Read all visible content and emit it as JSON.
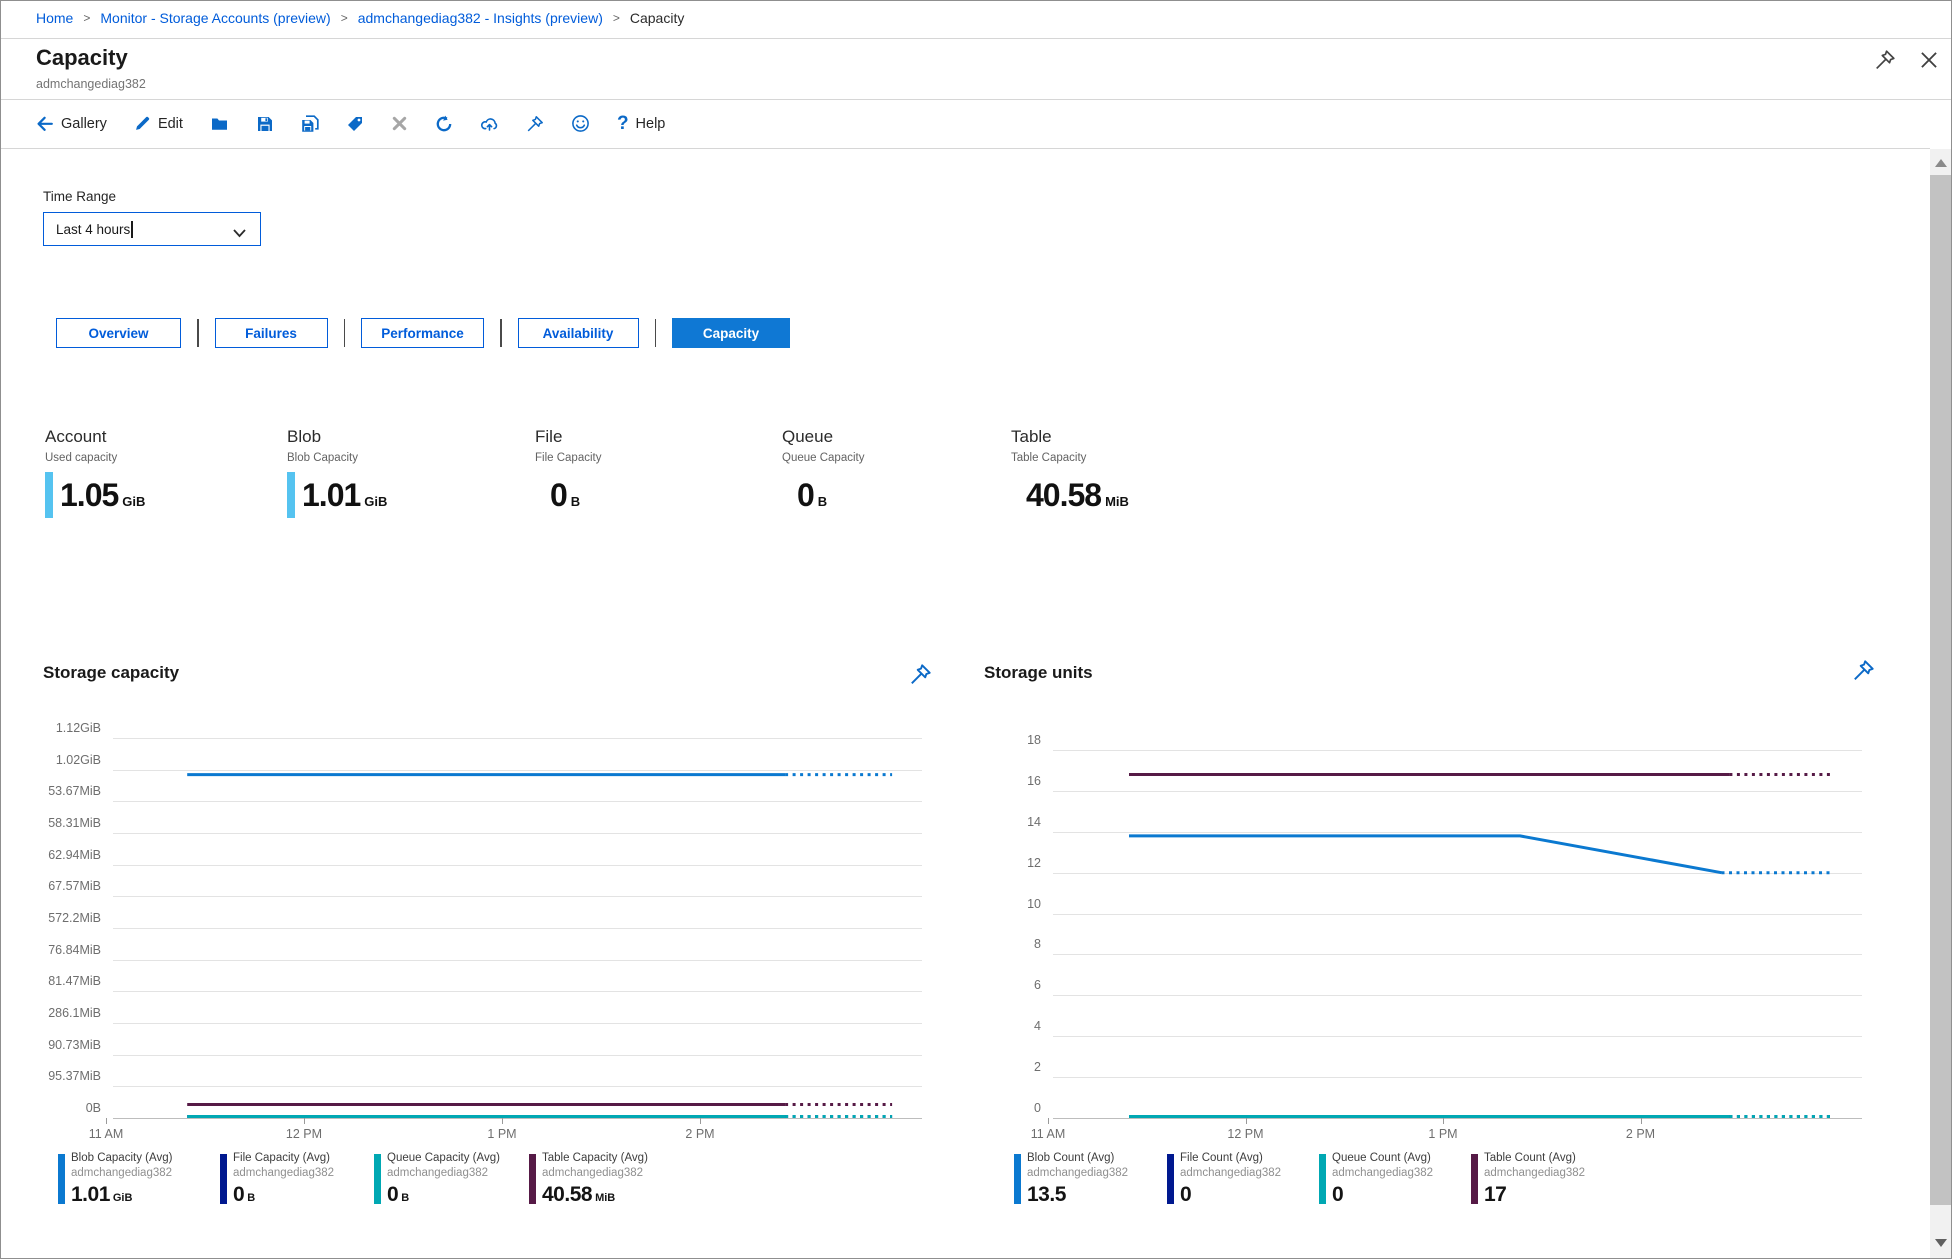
{
  "breadcrumb": {
    "separator": ">",
    "items": [
      {
        "label": "Home",
        "link": true
      },
      {
        "label": "Monitor - Storage Accounts (preview)",
        "link": true
      },
      {
        "label": "admchangediag382 - Insights (preview)",
        "link": true
      },
      {
        "label": "Capacity",
        "link": false
      }
    ]
  },
  "header": {
    "title": "Capacity",
    "subtitle": "admchangediag382"
  },
  "toolbar": {
    "items": [
      {
        "icon": "back-arrow",
        "label": "Gallery"
      },
      {
        "icon": "edit-pencil",
        "label": "Edit"
      },
      {
        "icon": "folder",
        "label": ""
      },
      {
        "icon": "save",
        "label": ""
      },
      {
        "icon": "save-copy",
        "label": ""
      },
      {
        "icon": "tag",
        "label": ""
      },
      {
        "icon": "discard-x",
        "label": ""
      },
      {
        "icon": "refresh",
        "label": ""
      },
      {
        "icon": "cloud-upload",
        "label": ""
      },
      {
        "icon": "pin",
        "label": ""
      },
      {
        "icon": "smiley-feedback",
        "label": ""
      },
      {
        "icon": "question-mark",
        "label": "Help"
      }
    ]
  },
  "time_range": {
    "label": "Time Range",
    "value": "Last 4 hours"
  },
  "tabs": [
    {
      "label": "Overview",
      "active": false
    },
    {
      "label": "Failures",
      "active": false
    },
    {
      "label": "Performance",
      "active": false
    },
    {
      "label": "Availability",
      "active": false
    },
    {
      "label": "Capacity",
      "active": true
    }
  ],
  "cards": [
    {
      "title": "Account",
      "metric": "Used capacity",
      "value": "1.05",
      "unit": "GiB",
      "bar": true
    },
    {
      "title": "Blob",
      "metric": "Blob Capacity",
      "value": "1.01",
      "unit": "GiB",
      "bar": true
    },
    {
      "title": "File",
      "metric": "File Capacity",
      "value": "0",
      "unit": "B",
      "bar": false
    },
    {
      "title": "Queue",
      "metric": "Queue Capacity",
      "value": "0",
      "unit": "B",
      "bar": false
    },
    {
      "title": "Table",
      "metric": "Table Capacity",
      "value": "40.58",
      "unit": "MiB",
      "bar": false
    }
  ],
  "colors": {
    "link_blue": "#015cda",
    "active_tab": "#0f78d4",
    "card_bar_light_blue": "#55c3f0",
    "blob": "#0b79d0",
    "file": "#00188f",
    "queue": "#00a8b3",
    "table": "#561a46"
  },
  "chart_data": [
    {
      "type": "line",
      "title": "Storage capacity",
      "y_axis": {
        "unit": "MiB",
        "max": 1144.44,
        "min": 0,
        "labels_top_to_bottom": [
          "1.12GiB",
          "1.02GiB",
          "53.67MiB",
          "58.31MiB",
          "62.94MiB",
          "67.57MiB",
          "572.2MiB",
          "76.84MiB",
          "81.47MiB",
          "286.1MiB",
          "90.73MiB",
          "95.37MiB",
          "0B"
        ]
      },
      "x_axis": {
        "labels": [
          "11 AM",
          "12 PM",
          "1 PM",
          "2 PM"
        ],
        "hours_shown": 4
      },
      "legend_position": "bottom",
      "grid": true,
      "series": [
        {
          "name": "Blob Capacity (Avg)",
          "resource": "admchangediag382",
          "color": "#0b79d0",
          "value": "1.01",
          "unit": "GiB",
          "points": [
            [
              0.41,
              1034.24
            ],
            [
              3.43,
              1034.24
            ]
          ],
          "forecast": [
            [
              3.43,
              1034.24
            ],
            [
              3.97,
              1034.24
            ]
          ]
        },
        {
          "name": "File Capacity (Avg)",
          "resource": "admchangediag382",
          "color": "#00188f",
          "value": "0",
          "unit": "B",
          "points": [
            [
              0.41,
              0
            ],
            [
              3.43,
              0
            ]
          ],
          "forecast": [
            [
              3.43,
              0
            ],
            [
              3.97,
              0
            ]
          ]
        },
        {
          "name": "Queue Capacity (Avg)",
          "resource": "admchangediag382",
          "color": "#00a8b3",
          "value": "0",
          "unit": "B",
          "points": [
            [
              0.41,
              0
            ],
            [
              3.43,
              0
            ]
          ],
          "forecast": [
            [
              3.43,
              0
            ],
            [
              3.97,
              0
            ]
          ]
        },
        {
          "name": "Table Capacity (Avg)",
          "resource": "admchangediag382",
          "color": "#561a46",
          "value": "40.58",
          "unit": "MiB",
          "points": [
            [
              0.41,
              40.58
            ],
            [
              3.43,
              40.58
            ]
          ],
          "forecast": [
            [
              3.43,
              40.58
            ],
            [
              3.97,
              40.58
            ]
          ]
        }
      ]
    },
    {
      "type": "line",
      "title": "Storage units",
      "y_axis": {
        "unit": "count",
        "max": 18,
        "min": 0,
        "labels_top_to_bottom": [
          "18",
          "16",
          "14",
          "12",
          "10",
          "8",
          "6",
          "4",
          "2",
          "0"
        ]
      },
      "x_axis": {
        "labels": [
          "11 AM",
          "12 PM",
          "1 PM",
          "2 PM"
        ],
        "hours_shown": 4
      },
      "legend_position": "bottom",
      "grid": true,
      "series": [
        {
          "name": "Blob Count (Avg)",
          "resource": "admchangediag382",
          "color": "#0b79d0",
          "value": "13.5",
          "unit": "",
          "points": [
            [
              0.41,
              13.8
            ],
            [
              2.39,
              13.8
            ],
            [
              3.41,
              12.0
            ]
          ],
          "forecast": [
            [
              3.41,
              12.0
            ],
            [
              3.97,
              12.0
            ]
          ]
        },
        {
          "name": "File Count (Avg)",
          "resource": "admchangediag382",
          "color": "#00188f",
          "value": "0",
          "unit": "",
          "points": [
            [
              0.41,
              0
            ],
            [
              3.45,
              0
            ]
          ],
          "forecast": [
            [
              3.45,
              0
            ],
            [
              3.97,
              0
            ]
          ]
        },
        {
          "name": "Queue Count (Avg)",
          "resource": "admchangediag382",
          "color": "#00a8b3",
          "value": "0",
          "unit": "",
          "points": [
            [
              0.41,
              0
            ],
            [
              3.45,
              0
            ]
          ],
          "forecast": [
            [
              3.45,
              0
            ],
            [
              3.97,
              0
            ]
          ]
        },
        {
          "name": "Table Count (Avg)",
          "resource": "admchangediag382",
          "color": "#561a46",
          "value": "17",
          "unit": "",
          "points": [
            [
              0.41,
              16.8
            ],
            [
              3.45,
              16.8
            ]
          ],
          "forecast": [
            [
              3.45,
              16.8
            ],
            [
              3.97,
              16.8
            ]
          ]
        }
      ]
    }
  ]
}
